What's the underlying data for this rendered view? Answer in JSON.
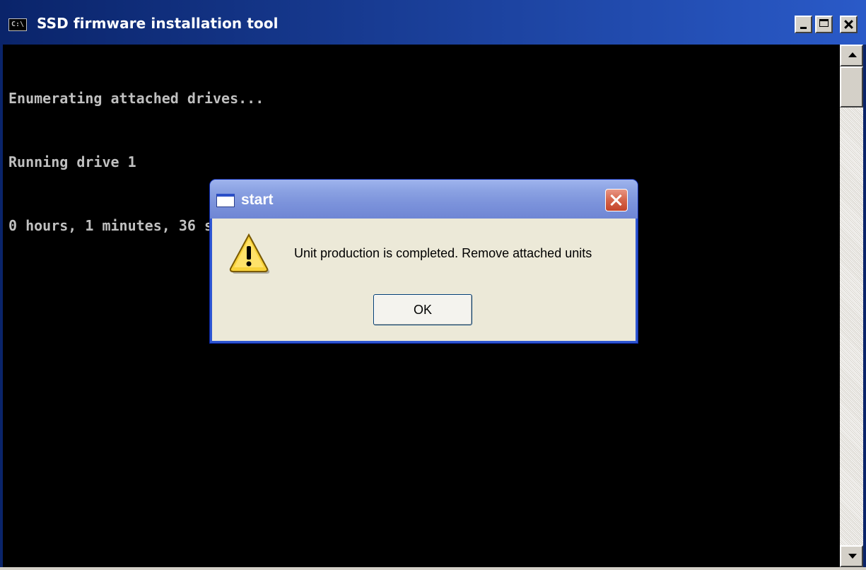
{
  "console": {
    "title": "SSD firmware installation tool",
    "app_icon_text": "C:\\",
    "lines": [
      "Enumerating attached drives...",
      "Running drive 1",
      "0 hours, 1 minutes, 36 seconds"
    ]
  },
  "dialog": {
    "title": "start",
    "message": "Unit production is completed. Remove attached units",
    "ok_label": "OK",
    "icon": "warning-icon"
  },
  "colors": {
    "console_bg": "#000000",
    "console_text": "#c0c0c0",
    "titlebar": "#0a246a",
    "dialog_body": "#ece9d8",
    "dialog_title": "#7c93db"
  }
}
